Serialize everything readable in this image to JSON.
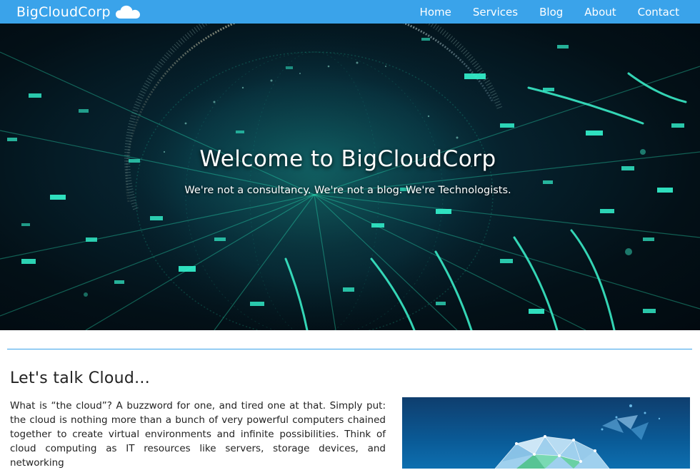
{
  "nav": {
    "brand": "BigCloudCorp",
    "brand_icon": "cloud-icon",
    "links": [
      "Home",
      "Services",
      "Blog",
      "About",
      "Contact"
    ]
  },
  "hero": {
    "title": "Welcome to BigCloudCorp",
    "subtitle": "We're not a consultancy. We're not a blog. We're Technologists."
  },
  "section": {
    "heading": "Let's talk Cloud...",
    "body": "What is “the cloud”? A buzzword for one, and tired one at that. Simply put: the cloud is nothing more than a bunch of very powerful computers chained together to create virtual environments and infinite possibilities. Think of cloud computing as IT resources like servers, storage devices, and networking"
  },
  "colors": {
    "navbar": "#3aa3ea",
    "divider": "#3aa3ea",
    "text": "#222222",
    "hero_glow": "#2ef3c4"
  }
}
